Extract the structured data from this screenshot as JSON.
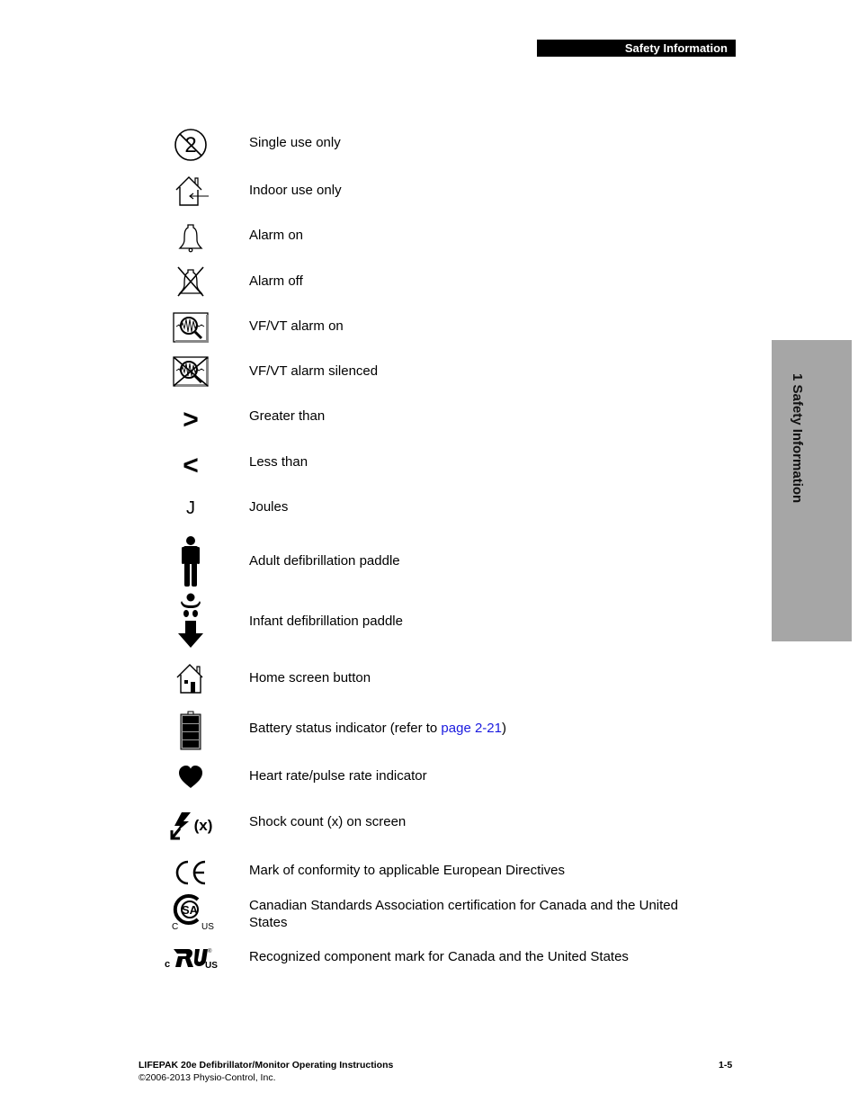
{
  "header": {
    "section_title": "Safety Information"
  },
  "side_tab": {
    "label": "1 Safety Information",
    "color": "#a6a6a6"
  },
  "symbols": [
    {
      "icon": "single-use-only-icon",
      "label": "Single use only"
    },
    {
      "icon": "indoor-use-only-icon",
      "label": "Indoor use only"
    },
    {
      "icon": "alarm-on-icon",
      "label": "Alarm on"
    },
    {
      "icon": "alarm-off-icon",
      "label": "Alarm off"
    },
    {
      "icon": "vf-vt-alarm-on-icon",
      "label": "VF/VT alarm on"
    },
    {
      "icon": "vf-vt-alarm-silenced-icon",
      "label": "VF/VT alarm silenced"
    },
    {
      "icon": "greater-than-icon",
      "label": "Greater than",
      "glyph": ">"
    },
    {
      "icon": "less-than-icon",
      "label": "Less than",
      "glyph": "<"
    },
    {
      "icon": "joules-icon",
      "label": "Joules",
      "glyph": "J"
    },
    {
      "icon": "adult-paddle-icon",
      "label": "Adult defibrillation paddle"
    },
    {
      "icon": "infant-paddle-icon",
      "label": "Infant defibrillation paddle"
    },
    {
      "icon": "home-screen-icon",
      "label": "Home screen button"
    },
    {
      "icon": "battery-status-icon",
      "label": "Battery status indicator (refer to ",
      "link": "page 2-21",
      "suffix": ")"
    },
    {
      "icon": "heart-icon",
      "label": "Heart rate/pulse rate indicator"
    },
    {
      "icon": "shock-count-icon",
      "label": "Shock count (x) on screen",
      "glyph": "(x)"
    },
    {
      "icon": "ce-mark-icon",
      "label": "Mark of conformity to applicable European Directives"
    },
    {
      "icon": "csa-mark-icon",
      "label": "Canadian Standards Association certification for Canada and the United States",
      "marks": [
        "C",
        "US"
      ]
    },
    {
      "icon": "ur-mark-icon",
      "label": "Recognized component mark for Canada and the United States",
      "marks": [
        "C",
        "US"
      ]
    }
  ],
  "footer": {
    "title": "LIFEPAK 20e Defibrillator/Monitor Operating Instructions",
    "copyright": "©2006-2013 Physio-Control, Inc.",
    "page_number": "1-5"
  },
  "colors": {
    "link": "#1a1adf",
    "header_bg": "#000000"
  }
}
